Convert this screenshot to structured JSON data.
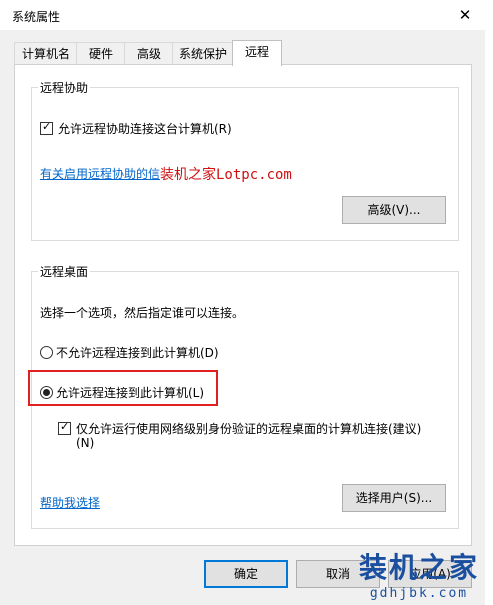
{
  "window": {
    "title": "系统属性",
    "close_glyph": "✕"
  },
  "tabs": [
    {
      "label": "计算机名"
    },
    {
      "label": "硬件"
    },
    {
      "label": "高级"
    },
    {
      "label": "系统保护"
    },
    {
      "label": "远程",
      "active": true
    }
  ],
  "remote_assistance": {
    "group_title": "远程协助",
    "checkbox_label": "允许远程协助连接这台计算机(R)",
    "checked": true,
    "link_text": "有关启用远程协助的信",
    "advanced_button": "高级(V)..."
  },
  "remote_desktop": {
    "group_title": "远程桌面",
    "instruction": "选择一个选项，然后指定谁可以连接。",
    "option_deny": "不允许远程连接到此计算机(D)",
    "option_allow": "允许远程连接到此计算机(L)",
    "selected": "option_allow",
    "nla_checkbox_label": "仅允许运行使用网络级别身份验证的远程桌面的计算机连接(建议)",
    "nla_checkbox_label_line2": "(N)",
    "nla_checked": true,
    "help_link": "帮助我选择",
    "select_users_button": "选择用户(S)..."
  },
  "footer": {
    "ok_button": "确定",
    "cancel_button": "取消",
    "apply_button": "应用(A)"
  },
  "watermark": {
    "site_text": "装机之家Lotpc.com",
    "corner_title": "装机之家",
    "corner_url": "gdhjbk.com"
  },
  "colors": {
    "link": "#0066cc",
    "highlight": "#e02020",
    "default_button_border": "#0078d7"
  }
}
